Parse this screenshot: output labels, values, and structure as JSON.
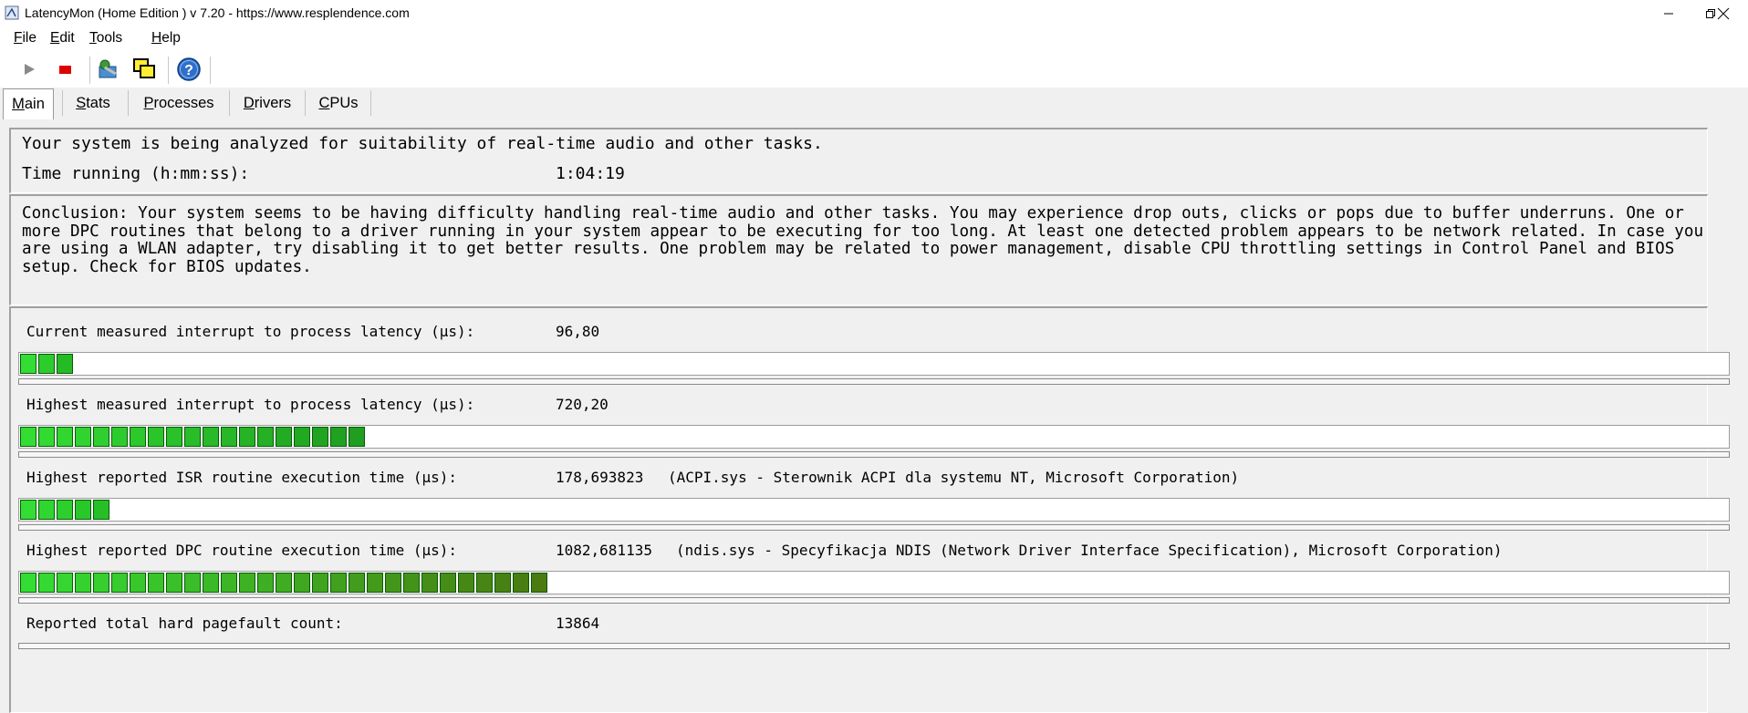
{
  "window": {
    "title": "LatencyMon  (Home Edition )  v 7.20 - https://www.resplendence.com"
  },
  "menu": [
    {
      "pre": "",
      "u": "F",
      "post": "ile"
    },
    {
      "pre": "",
      "u": "E",
      "post": "dit"
    },
    {
      "pre": "",
      "u": "T",
      "post": "ools"
    },
    {
      "pre": "",
      "u": "H",
      "post": "elp"
    }
  ],
  "toolbar": {
    "icons": [
      "play-icon",
      "stop-icon",
      "process-icon",
      "windows-icon",
      "help-icon"
    ]
  },
  "tabs": [
    {
      "u": "M",
      "post": "ain",
      "active": true
    },
    {
      "u": "S",
      "post": "tats",
      "active": false
    },
    {
      "u": "P",
      "post": "rocesses",
      "active": false
    },
    {
      "u": "D",
      "post": "rivers",
      "active": false
    },
    {
      "u": "C",
      "post": "PUs",
      "active": false
    }
  ],
  "status": {
    "line1": "Your system is being analyzed for suitability of real-time audio and other tasks.",
    "time_label": "Time running (h:mm:ss):",
    "time_value": "1:04:19"
  },
  "conclusion": "Conclusion: Your system seems to be having difficulty handling real-time audio and other tasks. You may experience drop outs, clicks or pops due to buffer underruns. One or more DPC routines that belong to a driver running in your system appear to be executing for too long. At least one detected problem appears to be network related. In case you are using a WLAN adapter, try disabling it to get better results. One problem may be related to power management, disable CPU throttling settings in Control Panel and BIOS setup. Check for BIOS updates.",
  "metrics": [
    {
      "label": "Current measured interrupt to process latency (µs):",
      "value": "96,80",
      "detail": "",
      "segments": 3,
      "colors": [
        "#33dd33",
        "#2bcc2b",
        "#24bb24"
      ]
    },
    {
      "label": "Highest measured interrupt to process latency (µs):",
      "value": "720,20",
      "detail": "",
      "segments": 19,
      "colors": [
        "#33dd33",
        "#1f9e1f"
      ]
    },
    {
      "label": "Highest reported ISR routine execution time (µs):",
      "value": "178,693823",
      "detail": "(ACPI.sys - Sterownik ACPI dla systemu NT, Microsoft Corporation)",
      "segments": 5,
      "colors": [
        "#33dd33",
        "#26c026"
      ]
    },
    {
      "label": "Highest reported DPC routine execution time (µs):",
      "value": "1082,681135",
      "detail": "(ndis.sys - Specyfikacja NDIS (Network Driver Interface Specification), Microsoft Corporation)",
      "segments": 29,
      "colors": [
        "#33dd33",
        "#4a7a10"
      ]
    },
    {
      "label": "Reported total hard pagefault count:",
      "value": "13864",
      "detail": "",
      "segments": 0,
      "colors": []
    }
  ]
}
